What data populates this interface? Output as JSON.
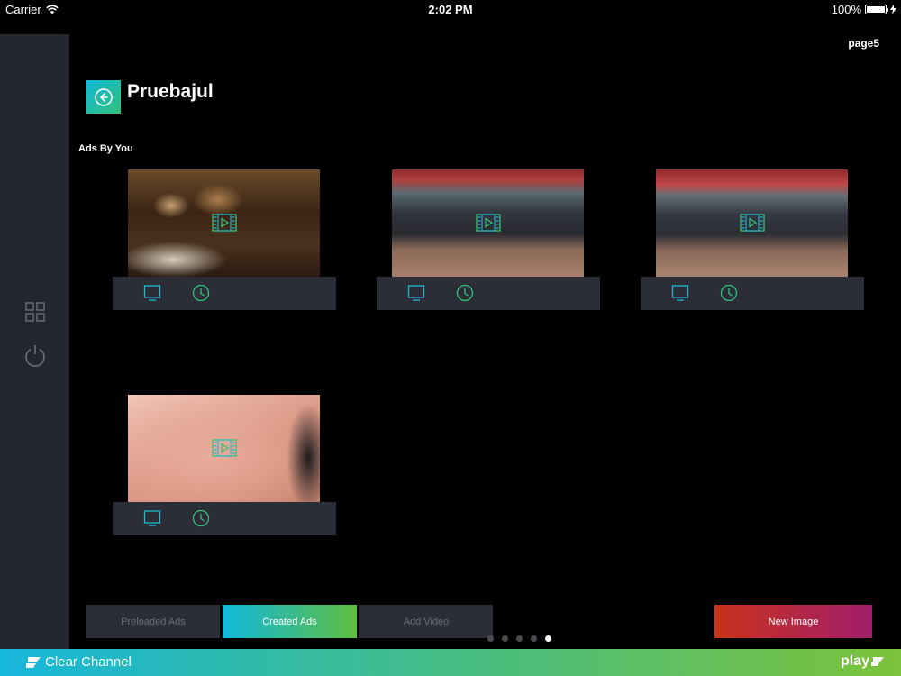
{
  "status_bar": {
    "carrier": "Carrier",
    "time": "2:02 PM",
    "battery_percent": "100%",
    "battery_level": 1.0
  },
  "page_label": "page5",
  "header": {
    "title": "Pruebajul"
  },
  "section": {
    "label": "Ads By You"
  },
  "ads": [
    {
      "thumbnail": "restaurant-interior",
      "type": "video"
    },
    {
      "thumbnail": "crowd-dancing",
      "type": "video"
    },
    {
      "thumbnail": "crowd-dancing",
      "type": "video"
    },
    {
      "thumbnail": "hand-closeup",
      "type": "video"
    }
  ],
  "tabs": [
    {
      "label": "Preloaded Ads",
      "active": false
    },
    {
      "label": "Created Ads",
      "active": true
    },
    {
      "label": "Add Video",
      "active": false
    }
  ],
  "new_image_label": "New Image",
  "pagination": {
    "total": 5,
    "current": 5
  },
  "footer": {
    "brand": "Clear Channel",
    "app": "play"
  },
  "colors": {
    "accent_gradient": [
      "#11b9dc",
      "#5fbd40"
    ],
    "new_image_gradient": [
      "#c8321b",
      "#a11e6a"
    ],
    "sidebar_bg": "#25272e",
    "card_bar_bg": "#2b2e36"
  }
}
